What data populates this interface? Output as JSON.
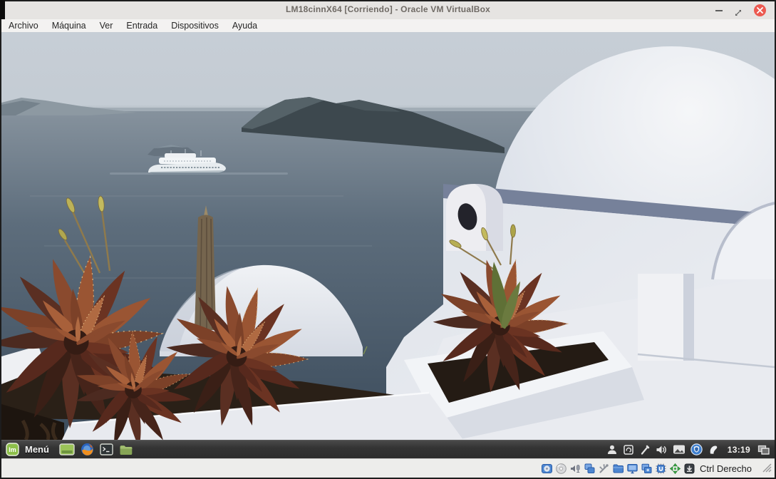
{
  "window": {
    "title": "LM18cinnX64 [Corriendo] - Oracle VM VirtualBox"
  },
  "menubar": {
    "items": [
      "Archivo",
      "Máquina",
      "Ver",
      "Entrada",
      "Dispositivos",
      "Ayuda"
    ]
  },
  "taskbar": {
    "menu_label": "Menú",
    "logo_text": "lm",
    "clock": "13:19",
    "launcher_icons": [
      "mint-menu",
      "show-desktop",
      "firefox",
      "terminal",
      "file-manager"
    ],
    "tray_icons": [
      "user",
      "sync-frame",
      "brush",
      "volume",
      "screenshot",
      "update-shield",
      "network",
      "window-list"
    ]
  },
  "statusbar": {
    "host_key_label": "Ctrl Derecho",
    "icons": [
      "hard-disks",
      "optical-drives",
      "audio",
      "network-adapters",
      "usb-devices",
      "shared-folders",
      "display",
      "recording",
      "features-chip",
      "mouse-integration",
      "keyboard-capture"
    ]
  },
  "colors": {
    "titlebar_bg": "#e6e4e2",
    "menubar_bg": "#f3f2f1",
    "close_button": "#ec5950",
    "taskbar_bg": "#3a3a3a",
    "statusbar_bg": "#ededeb",
    "mint_green": "#8dbf4a",
    "update_shield_blue": "#3d7fd0",
    "sea": "#5b6b7a",
    "sky": "#c9d0d7",
    "dome_white": "#e9ecf2",
    "aloe_red": "#7c4128"
  },
  "wallpaper": {
    "description": "Santorini caldera: hazy sky, dark blue-grey sea with distant islands and headland, cruise ship, large white dome building, white terrace planters with red aloe succulents and a closed umbrella pole"
  }
}
